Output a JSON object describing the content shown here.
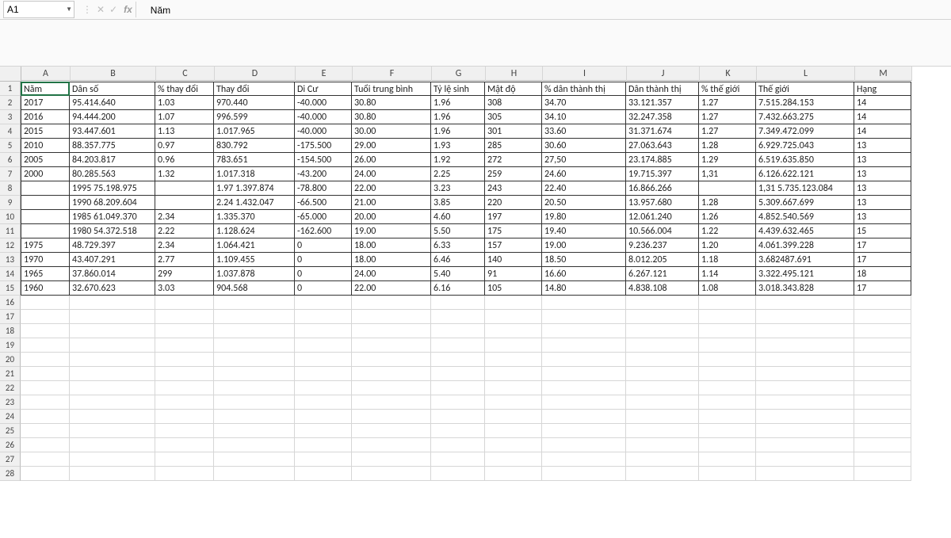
{
  "namebox": "A1",
  "formula": "Năm",
  "columns": [
    "A",
    "B",
    "C",
    "D",
    "E",
    "F",
    "G",
    "H",
    "I",
    "J",
    "K",
    "L",
    "M"
  ],
  "col_classes": [
    "cA",
    "cB",
    "cC",
    "cD",
    "cE",
    "cF",
    "cG",
    "cH",
    "cI",
    "cJ",
    "cK",
    "cL",
    "cM"
  ],
  "total_rows": 28,
  "data_rows": 15,
  "selected_cell": "A1",
  "table": [
    [
      "Năm",
      "Dân số",
      "% thay đổi",
      "Thay đổi",
      "Di Cư",
      "Tuổi trung bình",
      "Tỷ lệ sinh",
      "Mật độ",
      "% dân thành thị",
      "Dân thành thị",
      "% thế giới",
      "Thế giới",
      "Hạng"
    ],
    [
      "2017",
      "95.414.640",
      "1.03",
      "970.440",
      "-40.000",
      "30.80",
      "1.96",
      "308",
      "34.70",
      "33.121.357",
      "1.27",
      "7.515.284.153",
      "14"
    ],
    [
      "2016",
      "94.444.200",
      "1.07",
      "996.599",
      "-40.000",
      "30.80",
      "1.96",
      "305",
      "34.10",
      "32.247.358",
      "1.27",
      "7.432.663.275",
      "14"
    ],
    [
      "2015",
      "93.447.601",
      "1.13",
      "1.017.965",
      "-40.000",
      "30.00",
      "1.96",
      "301",
      "33.60",
      "31.371.674",
      "1.27",
      "7.349.472.099",
      "14"
    ],
    [
      "2010",
      "88.357.775",
      "0.97",
      "830.792",
      "-175.500",
      "29.00",
      "1.93",
      "285",
      "30.60",
      "27.063.643",
      "1.28",
      "6.929.725.043",
      "13"
    ],
    [
      "2005",
      "84.203.817",
      "0.96",
      "783.651",
      "-154.500",
      "26.00",
      "1.92",
      "272",
      "27,50",
      "23.174.885",
      "1.29",
      "6.519.635.850",
      "13"
    ],
    [
      "2000",
      "80.285.563",
      "1.32",
      "1.017.318",
      "-43.200",
      "24.00",
      "2.25",
      "259",
      "24.60",
      "19.715.397",
      "1,31",
      "6.126.622.121",
      "13"
    ],
    [
      "",
      "1995 75.198.975",
      "",
      "1.97 1.397.874",
      "-78.800",
      "22.00",
      "3.23",
      "243",
      "22.40",
      "16.866.266",
      "",
      "1,31 5.735.123.084",
      "13"
    ],
    [
      "",
      "1990 68.209.604",
      "",
      "2.24 1.432.047",
      "-66.500",
      "21.00",
      "3.85",
      "220",
      "20.50",
      "13.957.680",
      "1.28",
      "5.309.667.699",
      "13"
    ],
    [
      "",
      "1985 61.049.370",
      "2.34",
      "1.335.370",
      "-65.000",
      "20.00",
      "4.60",
      "197",
      "19.80",
      "12.061.240",
      "1.26",
      "4.852.540.569",
      "13"
    ],
    [
      "",
      "1980 54.372.518",
      "2.22",
      "1.128.624",
      "-162.600",
      "19.00",
      "5.50",
      "175",
      "19.40",
      "10.566.004",
      "1.22",
      "4.439.632.465",
      "15"
    ],
    [
      "1975",
      "48.729.397",
      "2.34",
      "1.064.421",
      "0",
      "18.00",
      "6.33",
      "157",
      "19.00",
      "9.236.237",
      "1.20",
      "4.061.399.228",
      "17"
    ],
    [
      "1970",
      "43.407.291",
      "2.77",
      "1.109.455",
      "0",
      "18.00",
      "6.46",
      "140",
      "18.50",
      "8.012.205",
      "1.18",
      "3.682487.691",
      "17"
    ],
    [
      "1965",
      "37.860.014",
      "299",
      "1.037.878",
      "0",
      "24.00",
      "5.40",
      "91",
      "16.60",
      "6.267.121",
      "1.14",
      "3.322.495.121",
      "18"
    ],
    [
      "1960",
      "32.670.623",
      "3.03",
      "904.568",
      "0",
      "22.00",
      "6.16",
      "105",
      "14.80",
      "4.838.108",
      "1.08",
      "3.018.343.828",
      "17"
    ]
  ],
  "icons": {
    "dropdown": "▼",
    "cancel": "✕",
    "enter": "✓",
    "vdots": "⋮"
  }
}
